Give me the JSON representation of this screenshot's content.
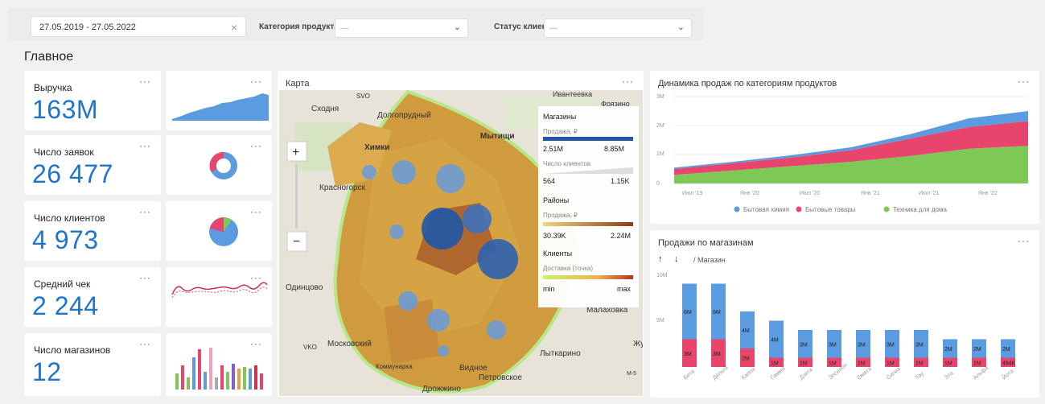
{
  "filters": {
    "date_range": "27.05.2019 - 27.05.2022",
    "category_label": "Категория продукта",
    "category_placeholder": "—",
    "status_label": "Статус клиента",
    "status_placeholder": "—"
  },
  "section_title": "Главное",
  "kpis": [
    {
      "label": "Выручка",
      "value": "163M"
    },
    {
      "label": "Число заявок",
      "value": "26 477"
    },
    {
      "label": "Число клиентов",
      "value": "4 973"
    },
    {
      "label": "Средний чек",
      "value": "2 244"
    },
    {
      "label": "Число магазинов",
      "value": "12"
    }
  ],
  "menu_dots": "···",
  "map": {
    "title": "Карта",
    "places": [
      "Сходня",
      "Долгопрудный",
      "Химки",
      "Мытищи",
      "Красногорск",
      "Одинцово",
      "Московский",
      "Видное",
      "Дрожжино",
      "Петровское",
      "Лыткарино",
      "Малаховка",
      "Ивантеевка",
      "Фрязино",
      "Коммунарка",
      "SVO",
      "VKO",
      "Жу",
      "М-5"
    ],
    "legend": {
      "stores_title": "Магазины",
      "sales_label": "Продажа, ₽",
      "stores_min": "2.51M",
      "stores_max": "8.85M",
      "clients_label": "Число клиентов",
      "clients_min": "564",
      "clients_max": "1.15K",
      "districts_title": "Районы",
      "districts_sales_label": "Продажа, ₽",
      "districts_min": "30.39K",
      "districts_max": "2.24M",
      "clients_title": "Клиенты",
      "delivery_label": "Доставка (точка)",
      "delivery_min": "min",
      "delivery_max": "max"
    }
  },
  "dynamics": {
    "title": "Динамика продаж по категориям продуктов",
    "y_ticks": [
      "3M",
      "2M",
      "1M",
      "0"
    ],
    "x_ticks": [
      "Июл '19",
      "Янв '20",
      "Июл '20",
      "Янв '21",
      "Июл '21",
      "Янв '22"
    ],
    "legend": [
      "Бытовая химия",
      "Бытовые товары",
      "Техника для дома"
    ]
  },
  "stores_chart": {
    "title": "Продажи по магазинам",
    "sort_up": "↑",
    "sort_down": "↓",
    "dimension": "/ Магазин",
    "y_ticks": [
      "10M",
      "5M"
    ]
  },
  "colors": {
    "blue": "#5b9be0",
    "red": "#e8456c",
    "green": "#7dc857",
    "kpi": "#1f74cc"
  },
  "chart_data": [
    {
      "type": "area",
      "title": "Динамика продаж по категориям продуктов",
      "x": [
        "Июл '19",
        "Янв '20",
        "Июл '20",
        "Янв '21",
        "Июл '21",
        "Янв '22",
        "Май '22"
      ],
      "series": [
        {
          "name": "Техника для дома",
          "values": [
            0.3,
            0.45,
            0.6,
            0.75,
            0.95,
            1.2,
            1.3
          ]
        },
        {
          "name": "Бытовые товары",
          "values": [
            0.2,
            0.25,
            0.3,
            0.4,
            0.6,
            0.75,
            0.85
          ]
        },
        {
          "name": "Бытовая химия",
          "values": [
            0.05,
            0.05,
            0.08,
            0.1,
            0.15,
            0.3,
            0.35
          ]
        }
      ],
      "ylim": [
        0,
        3
      ],
      "legend": "bottom"
    },
    {
      "type": "bar",
      "title": "Продажи по магазинам",
      "categories": [
        "Бета",
        "Дельта",
        "Каппа",
        "Гамма",
        "Дзета",
        "Эпсилон",
        "Омега",
        "Сигма",
        "Тау",
        "Эта",
        "Альфа",
        "Йота"
      ],
      "series": [
        {
          "name": "top",
          "values": [
            6,
            6,
            4,
            4,
            3,
            3,
            3,
            3,
            3,
            2,
            2,
            2
          ],
          "labels": [
            "6M",
            "6M",
            "4M",
            "4M",
            "3M",
            "3M",
            "3M",
            "3M",
            "3M",
            "2M",
            "2M",
            "2M"
          ]
        },
        {
          "name": "bottom",
          "values": [
            3,
            3,
            2,
            1,
            1,
            1,
            1,
            1,
            1,
            1,
            1,
            1
          ],
          "labels": [
            "3M",
            "3M",
            "2M",
            "1M",
            "1M",
            "1M",
            "1M",
            "1M",
            "1M",
            "1M",
            "1M",
            "494K"
          ]
        }
      ],
      "ylim": [
        0,
        10
      ]
    }
  ]
}
